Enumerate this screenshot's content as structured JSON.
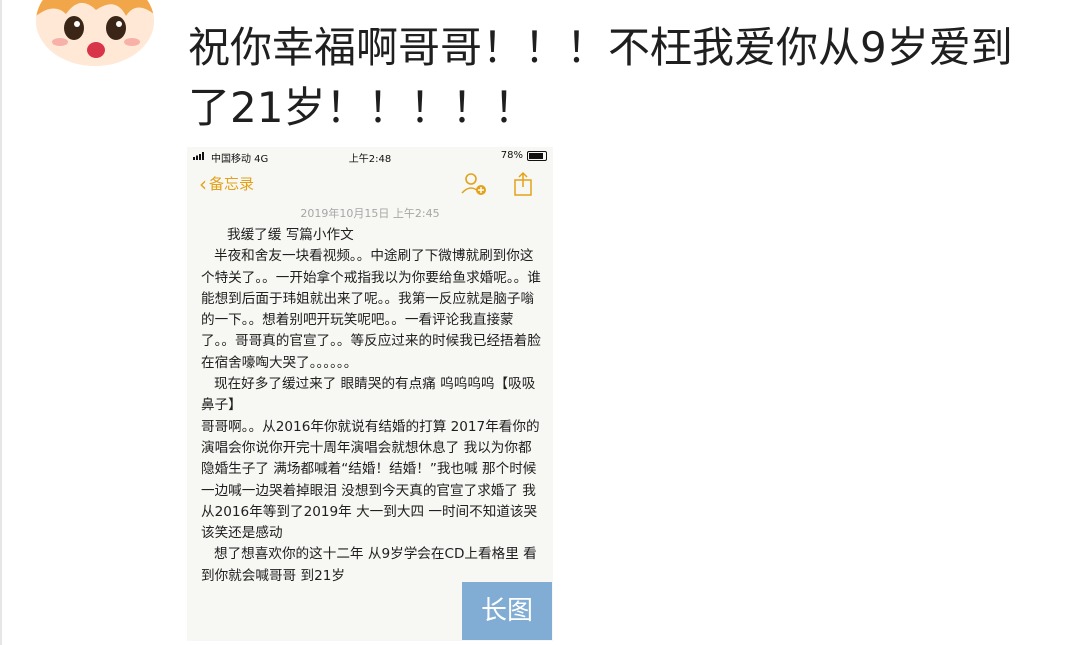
{
  "post": {
    "text": "祝你幸福啊哥哥！！！不枉我爱你从9岁爱到了21岁！！！！！"
  },
  "screenshot": {
    "status": {
      "carrier": "中国移动  4G",
      "time": "上午2:48",
      "battery": "78%"
    },
    "nav": {
      "back_label": "备忘录"
    },
    "date": "2019年10月15日 上午2:45",
    "lines": [
      "我缓了缓 写篇小作文",
      "半夜和舍友一块看视频。。中途刷了下微博就刷到你这个特关了。。一开始拿个戒指我以为你要给鱼求婚呢。。谁能想到后面于玮姐就出来了呢。。我第一反应就是脑子嗡的一下。。想着别吧开玩笑呢吧。。一看评论我直接蒙了。。哥哥真的官宣了。。等反应过来的时候我已经捂着脸在宿舍嚎啕大哭了。。。。。。",
      "现在好多了缓过来了 眼睛哭的有点痛 呜呜呜呜【吸吸鼻子】",
      "哥哥啊。。从2016年你就说有结婚的打算 2017年看你的演唱会你说你开完十周年演唱会就想休息了 我以为你都隐婚生子了 满场都喊着“结婚！结婚！”我也喊 那个时候一边喊一边哭着掉眼泪 没想到今天真的官宣了求婚了 我从2016年等到了2019年 大一到大四 一时间不知道该哭该笑还是感动",
      "想了想喜欢你的这十二年 从9岁学会在CD上看格里 看到你就会喊哥哥 到21岁"
    ]
  },
  "badge": "长图",
  "colors": {
    "accent": "#e3a21a",
    "badge_bg": "#6098cc"
  },
  "icons": [
    "avatar-cartoon",
    "signal-icon",
    "battery-icon",
    "chevron-left-icon",
    "add-person-icon",
    "share-icon"
  ]
}
